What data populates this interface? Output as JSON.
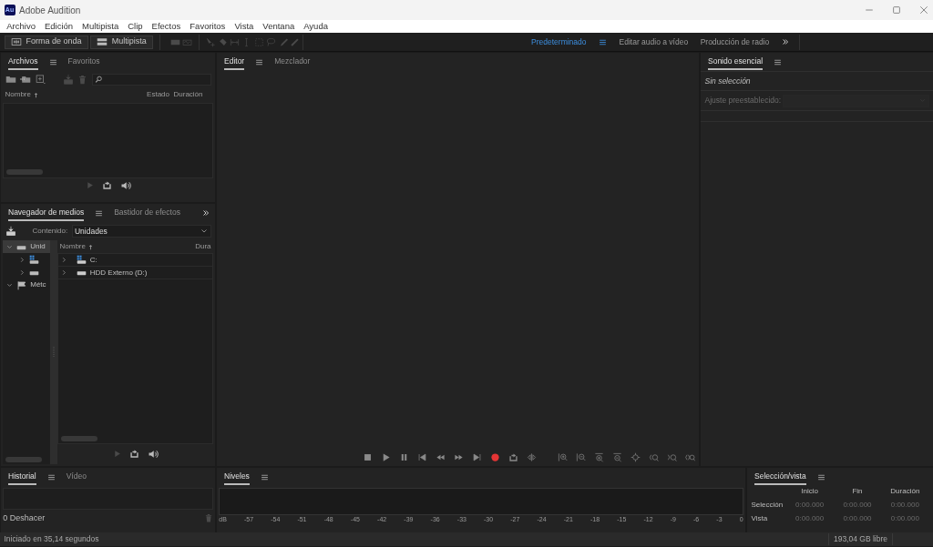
{
  "window": {
    "title": "Adobe Audition",
    "app_icon": "Au"
  },
  "menu": [
    "Archivo",
    "Edición",
    "Multipista",
    "Clip",
    "Efectos",
    "Favoritos",
    "Vista",
    "Ventana",
    "Ayuda"
  ],
  "view_buttons": [
    {
      "label": "Forma de onda",
      "kind": "waveform"
    },
    {
      "label": "Multipista",
      "kind": "multitrack"
    }
  ],
  "workspaces": [
    {
      "label": "Predeterminado",
      "selected": true
    },
    {
      "label": "Editar audio a vídeo",
      "selected": false
    },
    {
      "label": "Producción de radio",
      "selected": false
    }
  ],
  "files_panel": {
    "tabs": [
      {
        "label": "Archivos",
        "selected": true
      },
      {
        "label": "Favoritos",
        "selected": false
      }
    ],
    "columns": [
      "Nombre",
      "Estado",
      "Duración"
    ]
  },
  "media_browser": {
    "tabs": [
      {
        "label": "Navegador de medios",
        "selected": true
      },
      {
        "label": "Bastidor de efectos",
        "selected": false
      }
    ],
    "content_label": "Contenido:",
    "content_value": "Unidades",
    "tree": [
      {
        "label": "Unid",
        "kind": "drives",
        "selected": true,
        "expanded": true,
        "children": [
          {
            "kind": "windows-drive",
            "selected": false,
            "expanded": false
          },
          {
            "kind": "drive",
            "selected": false,
            "expanded": false
          }
        ]
      },
      {
        "label": "Métc",
        "kind": "shortcuts",
        "selected": false,
        "expanded": true
      }
    ],
    "columns": [
      "Nombre",
      "Dura"
    ],
    "rows": [
      {
        "label": "C:",
        "kind": "windows-drive",
        "expanded": false
      },
      {
        "label": "HDD Externo (D:)",
        "kind": "drive",
        "expanded": false
      }
    ]
  },
  "history_panel": {
    "tabs": [
      {
        "label": "Historial",
        "selected": true
      },
      {
        "label": "Vídeo",
        "selected": false
      }
    ],
    "undo_count": "0 Deshacer"
  },
  "editor_panel": {
    "tabs": [
      {
        "label": "Editor",
        "selected": true
      },
      {
        "label": "Mezclador",
        "selected": false
      }
    ]
  },
  "levels_panel": {
    "title": "Niveles",
    "scale": [
      "dB",
      "-57",
      "-54",
      "-51",
      "-48",
      "-45",
      "-42",
      "-39",
      "-36",
      "-33",
      "-30",
      "-27",
      "-24",
      "-21",
      "-18",
      "-15",
      "-12",
      "-9",
      "-6",
      "-3",
      "0"
    ]
  },
  "essential_sound": {
    "title": "Sonido esencial",
    "status": "Sin selección",
    "preset_label": "Ajuste preestablecido:",
    "disabled": true
  },
  "selection_view": {
    "title": "Selección/vista",
    "columns": [
      "Inicio",
      "Fin",
      "Duración"
    ],
    "rows": [
      {
        "label": "Selección",
        "values": [
          "0:00.000",
          "0:00.000",
          "0:00.000"
        ]
      },
      {
        "label": "Vista",
        "values": [
          "0:00.000",
          "0:00.000",
          "0:00.000"
        ]
      }
    ]
  },
  "status_bar": {
    "message": "Iniciado en 35,14 segundos",
    "disk_free": "193,04 GB libre"
  }
}
